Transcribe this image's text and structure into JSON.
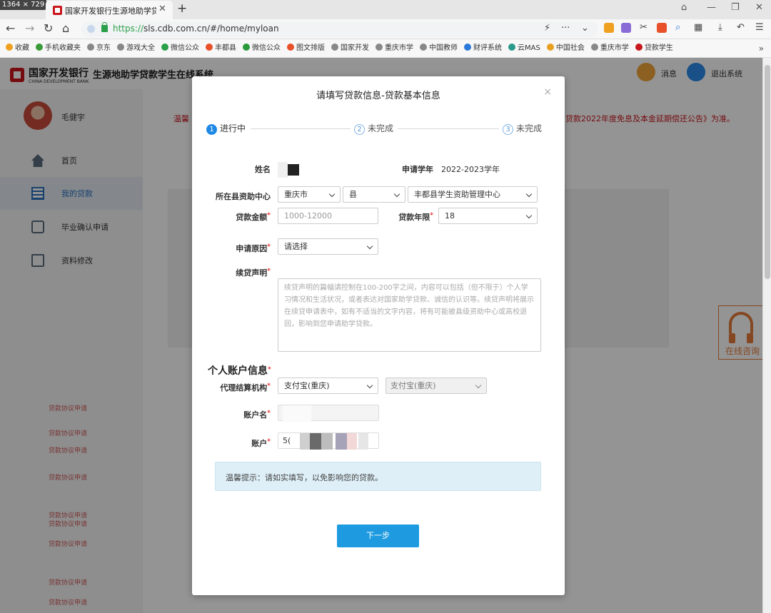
{
  "browser": {
    "dims_badge": "1364 × 729",
    "tab_title": "国家开发银行生源地助学贷款",
    "url_scheme": "https://",
    "url_rest": "sls.cdb.com.cn/#/home/myloan",
    "bookmarks": [
      "收藏",
      "手机收藏夹",
      "京东",
      "游戏大全",
      "微信公众",
      "丰都县",
      "微信公众",
      "图文排版",
      "国家开发",
      "重庆市学",
      "中国教师",
      "财评系统",
      "云MAS",
      "中国社会",
      "重庆市学",
      "贷款学生"
    ],
    "bookmarks_more": "»"
  },
  "site": {
    "bank_name": "国家开发银行",
    "bank_en": "CHINA DEVELOPMENT BANK",
    "system_name": "生源地助学贷款学生在线系统",
    "messages": "消息",
    "logout": "退出系统",
    "username": "毛健宇",
    "nav": [
      "首页",
      "我的贷款",
      "毕业确认申请",
      "资料修改"
    ],
    "notice_left": "温馨",
    "notice_right": "贷款2022年度免息及本金延期偿还公告》为准。",
    "consult": "在线咨询",
    "stamp_text": "贷款协议申请"
  },
  "modal": {
    "title": "请填写贷款信息-贷款基本信息",
    "close": "×",
    "steps": [
      {
        "num": "1",
        "label": "进行中"
      },
      {
        "num": "2",
        "label": "未完成"
      },
      {
        "num": "3",
        "label": "未完成"
      }
    ],
    "name_label": "姓名",
    "year_label": "申请学年",
    "year_value": "2022-2023学年",
    "center_label": "所在县资助中心",
    "center_city": "重庆市",
    "center_county": "县",
    "center_office": "丰都县学生资助管理中心",
    "amount_label": "贷款金额",
    "amount_placeholder": "1000-12000",
    "term_label": "贷款年限",
    "term_value": "18",
    "reason_label": "申请原因",
    "reason_value": "请选择",
    "statement_label": "续贷声明",
    "statement_placeholder": "续贷声明的篇幅请控制在100-200字之间，内容可以包括（但不限于）个人学习情况和生活状况，或者表达对国家助学贷款、诚信的认识等。续贷声明将展示在续贷申请表中，如有不适当的文字内容，将有可能被县级资助中心或高校退回，影响到您申请助学贷款。",
    "account_section": "个人账户信息",
    "agency_label": "代理结算机构",
    "agency_value": "支付宝(重庆)",
    "agency_display": "支付宝(重庆)",
    "account_name_label": "账户名",
    "account_label": "账户",
    "account_prefix": "5(",
    "tip": "温馨提示：请如实填写，以免影响您的贷款。",
    "next": "下一步"
  }
}
